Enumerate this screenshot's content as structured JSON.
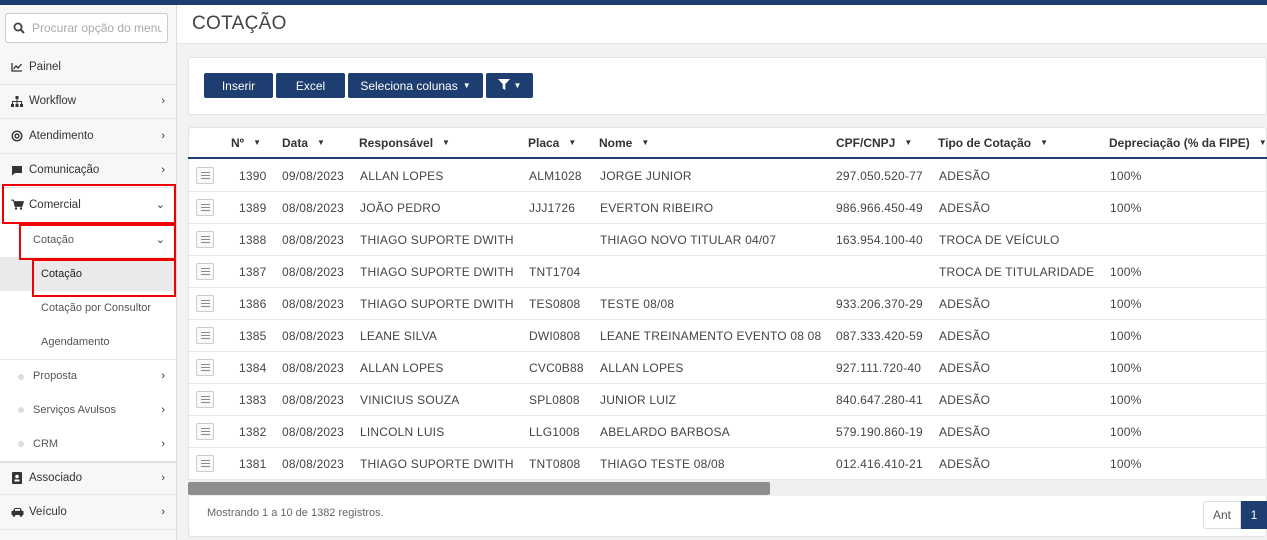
{
  "search": {
    "placeholder": "Procurar opção do menu"
  },
  "sidebar": {
    "items": [
      {
        "label": "Painel",
        "icon": "chart-line-icon"
      },
      {
        "label": "Workflow",
        "icon": "sitemap-icon"
      },
      {
        "label": "Atendimento",
        "icon": "support-icon"
      },
      {
        "label": "Comunicação",
        "icon": "comment-icon"
      },
      {
        "label": "Comercial",
        "icon": "cart-icon"
      }
    ],
    "comercial_sub": {
      "cotacao": "Cotação",
      "cotacao_items": [
        "Cotação",
        "Cotação por Consultor",
        "Agendamento"
      ],
      "proposta": "Proposta",
      "servicos": "Serviços Avulsos",
      "crm": "CRM"
    },
    "bottom_items": [
      {
        "label": "Associado",
        "icon": "id-card-icon"
      },
      {
        "label": "Veículo",
        "icon": "car-icon"
      }
    ]
  },
  "page": {
    "title": "COTAÇÃO"
  },
  "toolbar": {
    "insert": "Inserir",
    "excel": "Excel",
    "columns": "Seleciona colunas"
  },
  "table": {
    "headers": [
      "Nº",
      "Data",
      "Responsável",
      "Placa",
      "Nome",
      "CPF/CNPJ",
      "Tipo de Cotação",
      "Depreciação (% da FIPE)"
    ],
    "rows": [
      [
        "1390",
        "09/08/2023",
        "ALLAN LOPES",
        "ALM1028",
        "JORGE JUNIOR",
        "297.050.520-77",
        "ADESÃO",
        "100%"
      ],
      [
        "1389",
        "08/08/2023",
        "JOÃO PEDRO",
        "JJJ1726",
        "EVERTON RIBEIRO",
        "986.966.450-49",
        "ADESÃO",
        "100%"
      ],
      [
        "1388",
        "08/08/2023",
        "THIAGO SUPORTE DWITH",
        "",
        "THIAGO NOVO TITULAR 04/07",
        "163.954.100-40",
        "TROCA DE VEÍCULO",
        ""
      ],
      [
        "1387",
        "08/08/2023",
        "THIAGO SUPORTE DWITH",
        "TNT1704",
        "",
        "",
        "TROCA DE TITULARIDADE",
        "100%"
      ],
      [
        "1386",
        "08/08/2023",
        "THIAGO SUPORTE DWITH",
        "TES0808",
        "TESTE 08/08",
        "933.206.370-29",
        "ADESÃO",
        "100%"
      ],
      [
        "1385",
        "08/08/2023",
        "LEANE SILVA",
        "DWI0808",
        "LEANE TREINAMENTO EVENTO 08 08",
        "087.333.420-59",
        "ADESÃO",
        "100%"
      ],
      [
        "1384",
        "08/08/2023",
        "ALLAN LOPES",
        "CVC0B88",
        "ALLAN LOPES",
        "927.111.720-40",
        "ADESÃO",
        "100%"
      ],
      [
        "1383",
        "08/08/2023",
        "VINICIUS SOUZA",
        "SPL0808",
        "JUNIOR LUIZ",
        "840.647.280-41",
        "ADESÃO",
        "100%"
      ],
      [
        "1382",
        "08/08/2023",
        "LINCOLN LUIS",
        "LLG1008",
        "ABELARDO BARBOSA",
        "579.190.860-19",
        "ADESÃO",
        "100%"
      ],
      [
        "1381",
        "08/08/2023",
        "THIAGO SUPORTE DWITH",
        "TNT0808",
        "THIAGO TESTE 08/08",
        "012.416.410-21",
        "ADESÃO",
        "100%"
      ]
    ]
  },
  "footer": {
    "info": "Mostrando 1 a 10 de 1382 registros.",
    "prev": "Ant",
    "page": "1"
  },
  "colors": {
    "primary": "#1e3d70",
    "highlight": "#e00000"
  }
}
